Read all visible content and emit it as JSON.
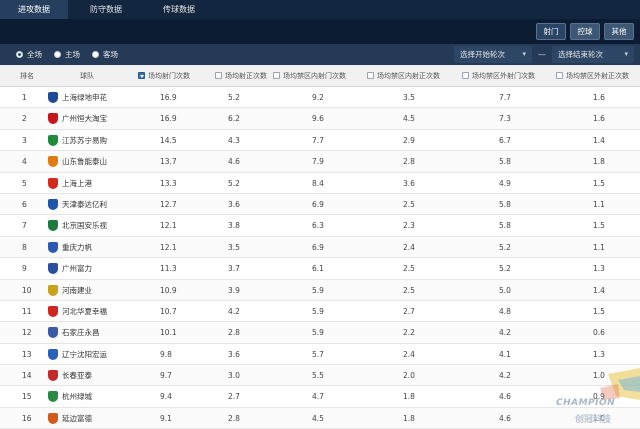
{
  "tabs": [
    {
      "label": "进攻数据",
      "active": true
    },
    {
      "label": "防守数据",
      "active": false
    },
    {
      "label": "传球数据",
      "active": false
    }
  ],
  "toolbar": {
    "buttons": [
      {
        "label": "射门",
        "active": true
      },
      {
        "label": "控球",
        "active": false
      },
      {
        "label": "其他",
        "active": false
      }
    ]
  },
  "filters": {
    "venue": [
      {
        "label": "全场",
        "selected": true
      },
      {
        "label": "主场",
        "selected": false
      },
      {
        "label": "客场",
        "selected": false
      }
    ],
    "start_round": "选择开始轮次",
    "separator": "—",
    "end_round": "选择结束轮次"
  },
  "columns": [
    "排名",
    "球队",
    "场均射门次数",
    "场均射正次数",
    "场均禁区内射门次数",
    "场均禁区内射正次数",
    "场均禁区外射门次数",
    "场均禁区外射正次数"
  ],
  "rows": [
    {
      "rank": "1",
      "team": "上海绿地申花",
      "color": "#1f4a9a",
      "shots": "16.9",
      "on_target": "5.2",
      "box_shots": "9.2",
      "box_on": "3.5",
      "out_shots": "7.7",
      "out_on": "1.6"
    },
    {
      "rank": "2",
      "team": "广州恒大淘宝",
      "color": "#c8161d",
      "shots": "16.9",
      "on_target": "6.2",
      "box_shots": "9.6",
      "box_on": "4.5",
      "out_shots": "7.3",
      "out_on": "1.6"
    },
    {
      "rank": "3",
      "team": "江苏苏宁易购",
      "color": "#1f8a3b",
      "shots": "14.5",
      "on_target": "4.3",
      "box_shots": "7.7",
      "box_on": "2.9",
      "out_shots": "6.7",
      "out_on": "1.4"
    },
    {
      "rank": "4",
      "team": "山东鲁能泰山",
      "color": "#e07a12",
      "shots": "13.7",
      "on_target": "4.6",
      "box_shots": "7.9",
      "box_on": "2.8",
      "out_shots": "5.8",
      "out_on": "1.8"
    },
    {
      "rank": "5",
      "team": "上海上港",
      "color": "#d42a1c",
      "shots": "13.3",
      "on_target": "5.2",
      "box_shots": "8.4",
      "box_on": "3.6",
      "out_shots": "4.9",
      "out_on": "1.5"
    },
    {
      "rank": "6",
      "team": "天津泰达亿利",
      "color": "#1d56a8",
      "shots": "12.7",
      "on_target": "3.6",
      "box_shots": "6.9",
      "box_on": "2.5",
      "out_shots": "5.8",
      "out_on": "1.1"
    },
    {
      "rank": "7",
      "team": "北京国安乐视",
      "color": "#1c7a3e",
      "shots": "12.1",
      "on_target": "3.8",
      "box_shots": "6.3",
      "box_on": "2.3",
      "out_shots": "5.8",
      "out_on": "1.5"
    },
    {
      "rank": "8",
      "team": "重庆力帆",
      "color": "#2a5bb0",
      "shots": "12.1",
      "on_target": "3.5",
      "box_shots": "6.9",
      "box_on": "2.4",
      "out_shots": "5.2",
      "out_on": "1.1"
    },
    {
      "rank": "9",
      "team": "广州富力",
      "color": "#2b4f9e",
      "shots": "11.3",
      "on_target": "3.7",
      "box_shots": "6.1",
      "box_on": "2.5",
      "out_shots": "5.2",
      "out_on": "1.3"
    },
    {
      "rank": "10",
      "team": "河南建业",
      "color": "#c9a11b",
      "shots": "10.9",
      "on_target": "3.9",
      "box_shots": "5.9",
      "box_on": "2.5",
      "out_shots": "5.0",
      "out_on": "1.4"
    },
    {
      "rank": "11",
      "team": "河北华夏幸福",
      "color": "#d0241e",
      "shots": "10.7",
      "on_target": "4.2",
      "box_shots": "5.9",
      "box_on": "2.7",
      "out_shots": "4.8",
      "out_on": "1.5"
    },
    {
      "rank": "12",
      "team": "石家庄永昌",
      "color": "#3a5aa8",
      "shots": "10.1",
      "on_target": "2.8",
      "box_shots": "5.9",
      "box_on": "2.2",
      "out_shots": "4.2",
      "out_on": "0.6"
    },
    {
      "rank": "13",
      "team": "辽宁沈阳宏运",
      "color": "#2a62b8",
      "shots": "9.8",
      "on_target": "3.6",
      "box_shots": "5.7",
      "box_on": "2.4",
      "out_shots": "4.1",
      "out_on": "1.3"
    },
    {
      "rank": "14",
      "team": "长春亚泰",
      "color": "#c42a2a",
      "shots": "9.7",
      "on_target": "3.0",
      "box_shots": "5.5",
      "box_on": "2.0",
      "out_shots": "4.2",
      "out_on": "1.0"
    },
    {
      "rank": "15",
      "team": "杭州绿城",
      "color": "#2a8a44",
      "shots": "9.4",
      "on_target": "2.7",
      "box_shots": "4.7",
      "box_on": "1.8",
      "out_shots": "4.6",
      "out_on": "0.9"
    },
    {
      "rank": "16",
      "team": "延边富德",
      "color": "#d25a1a",
      "shots": "9.1",
      "on_target": "2.8",
      "box_shots": "4.5",
      "box_on": "1.8",
      "out_shots": "4.6",
      "out_on": "1.0"
    }
  ],
  "watermark": {
    "brand": "CHAMPION",
    "cn": "创冠科技"
  }
}
